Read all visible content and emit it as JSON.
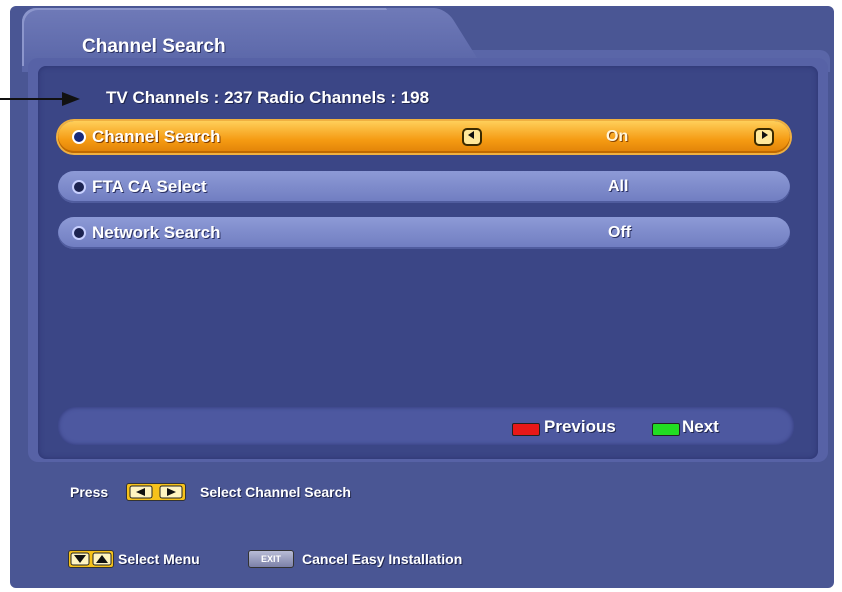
{
  "window": {
    "title": "Channel Search"
  },
  "header": {
    "counts_text": "TV Channels : 237  Radio Channels : 198"
  },
  "menu": {
    "items": [
      {
        "label": "Channel Search",
        "value": "On",
        "selected": true
      },
      {
        "label": "FTA CA Select",
        "value": "All",
        "selected": false
      },
      {
        "label": "Network Search",
        "value": "Off",
        "selected": false
      }
    ]
  },
  "nav": {
    "previous_label": "Previous",
    "next_label": "Next"
  },
  "help": {
    "press_label": "Press",
    "press_action": "Select Channel Search",
    "menu_action": "Select Menu",
    "exit_key": "EXIT",
    "exit_action": "Cancel Easy Installation"
  },
  "colors": {
    "background": "#4a5694",
    "selected_row": "#f59a12",
    "row": "#7f8ccc",
    "red_key": "#e81818",
    "green_key": "#22dd22",
    "yellow_key": "#f7c21a"
  },
  "icons": {
    "left": "left-arrow-icon",
    "right": "right-arrow-icon",
    "pointer": "arrow-pointer-icon"
  }
}
